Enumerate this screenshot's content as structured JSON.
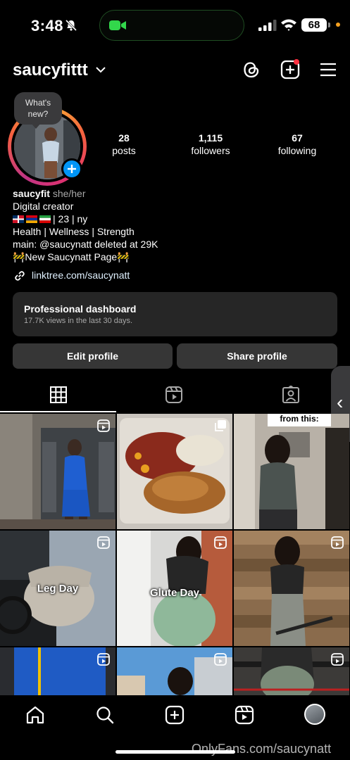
{
  "status_bar": {
    "time": "3:48",
    "battery": "68"
  },
  "header": {
    "username": "saucyfittt"
  },
  "profile": {
    "bubble_text": "What's new?",
    "stats": [
      {
        "value": "28",
        "label": "posts"
      },
      {
        "value": "1,115",
        "label": "followers"
      },
      {
        "value": "67",
        "label": "following"
      }
    ],
    "name": "saucyfit",
    "pronouns": "she/her",
    "category": "Digital creator",
    "bio_line2_suffix": "| 23 | ny",
    "bio_line3": "Health | Wellness | Strength",
    "bio_line4": "main: @saucynatt deleted at 29K",
    "bio_line5": "🚧New Saucynatt Page🚧",
    "link": "linktree.com/saucynatt"
  },
  "dashboard": {
    "title": "Professional dashboard",
    "subtitle": "17.7K views in the last 30 days."
  },
  "buttons": {
    "edit": "Edit profile",
    "share": "Share profile"
  },
  "grid": {
    "top_text": "from this:",
    "labels": {
      "leg": "Leg Day",
      "glute": "Glute Day"
    }
  },
  "watermark": "OnlyFans.com/saucynatt",
  "colors": {
    "accent": "#0095f6",
    "surface": "#262626",
    "button": "#363636"
  }
}
